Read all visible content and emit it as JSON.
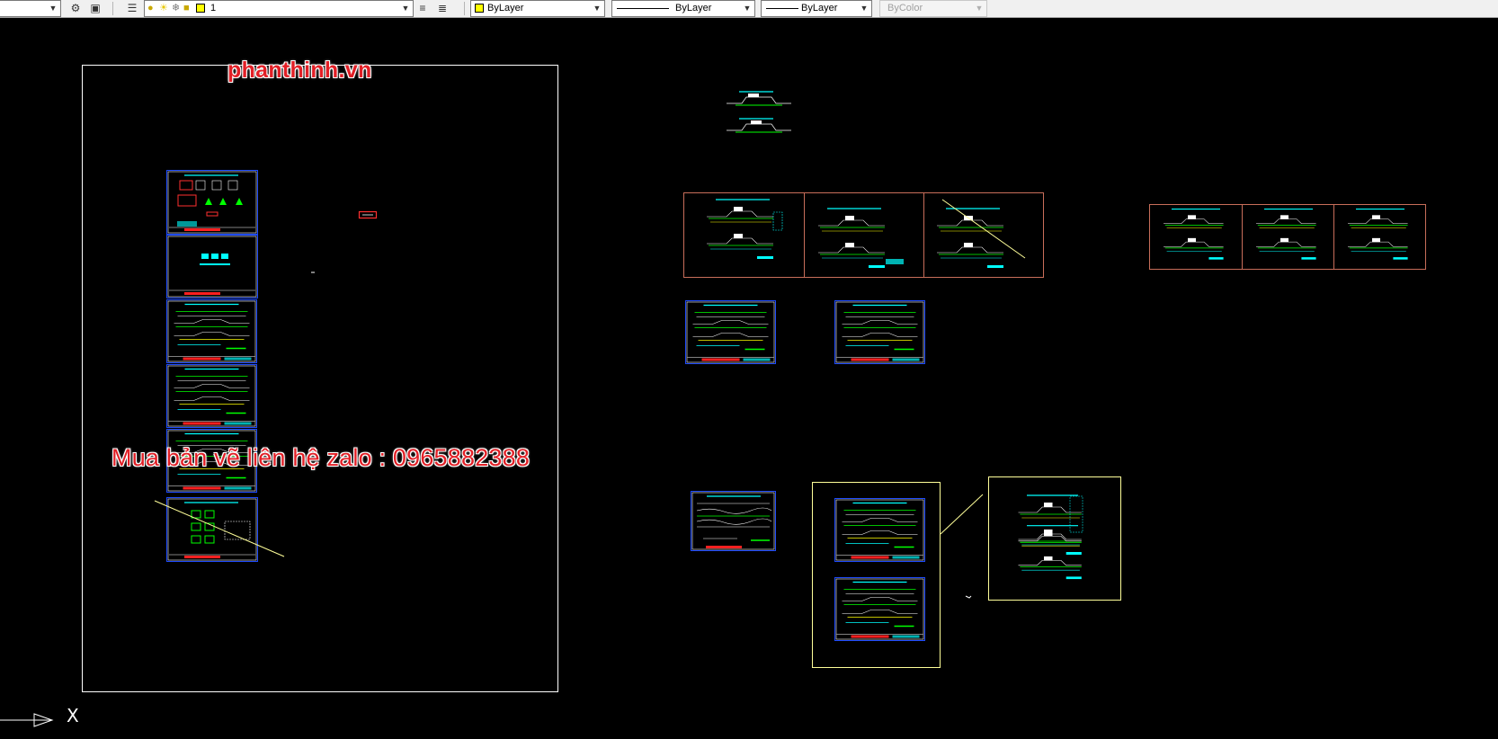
{
  "toolbar": {
    "layer_combo": {
      "current_layer": "1",
      "state_icons": [
        "lightbulb-icon",
        "sun-icon",
        "freeze-icon",
        "lock-icon"
      ],
      "swatch_color": "#ffff00"
    },
    "color_combo": {
      "label": "ByLayer",
      "swatch_color": "#ffff00"
    },
    "linetype_combo": {
      "label": "ByLayer"
    },
    "lineweight_combo": {
      "label": "ByLayer"
    },
    "plotstyle_combo": {
      "label": "ByColor",
      "disabled": true
    }
  },
  "watermarks": {
    "site": "phanthinh.vn",
    "contact": "Mua bản vẽ liên hệ zalo : 0965882388"
  },
  "colors": {
    "background": "#000000",
    "sheet_border": "#ffffff",
    "drawing_frame": "#0000ff",
    "group_frame_red": "#c86e5a",
    "group_frame_yellow": "#ffff99",
    "cyan": "#00ffff",
    "green": "#00ff00",
    "watermark": "#e21f26"
  },
  "ucs_icon": {
    "x_label": "X"
  }
}
